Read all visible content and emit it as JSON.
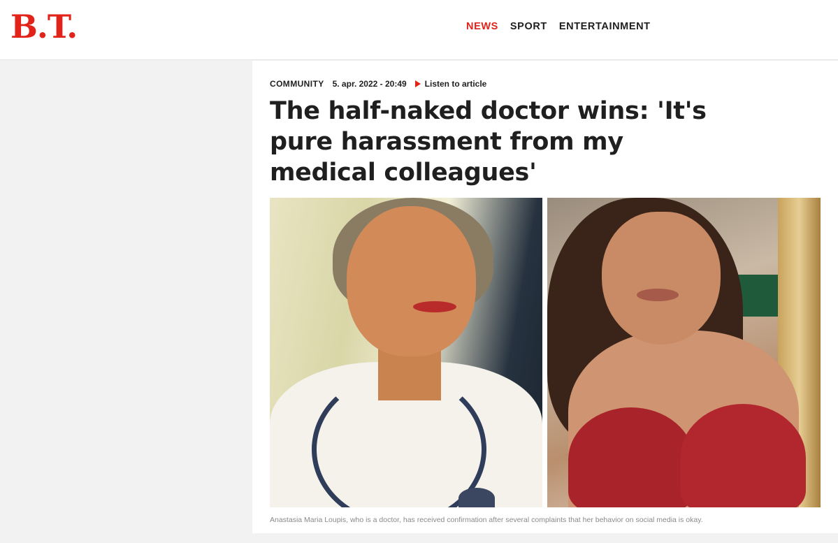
{
  "header": {
    "logo": "B.T.",
    "nav": [
      {
        "label": "NEWS",
        "active": true
      },
      {
        "label": "SPORT",
        "active": false
      },
      {
        "label": "ENTERTAINMENT",
        "active": false
      }
    ]
  },
  "article": {
    "section": "COMMUNITY",
    "date": "5. apr. 2022 - 20:49",
    "listen_label": "Listen to article",
    "headline": "The half-naked doctor wins: 'It's pure harassment from my medical colleagues'",
    "caption": "Anastasia Maria Loupis, who is a doctor, has received confirmation after several complaints that her behavior on social media is okay."
  },
  "colors": {
    "brand": "#e2231a",
    "text": "#1f1f1f",
    "caption": "#8a8a8a",
    "page_bg": "#f2f2f2"
  },
  "icons": {
    "listen": "play-icon"
  }
}
